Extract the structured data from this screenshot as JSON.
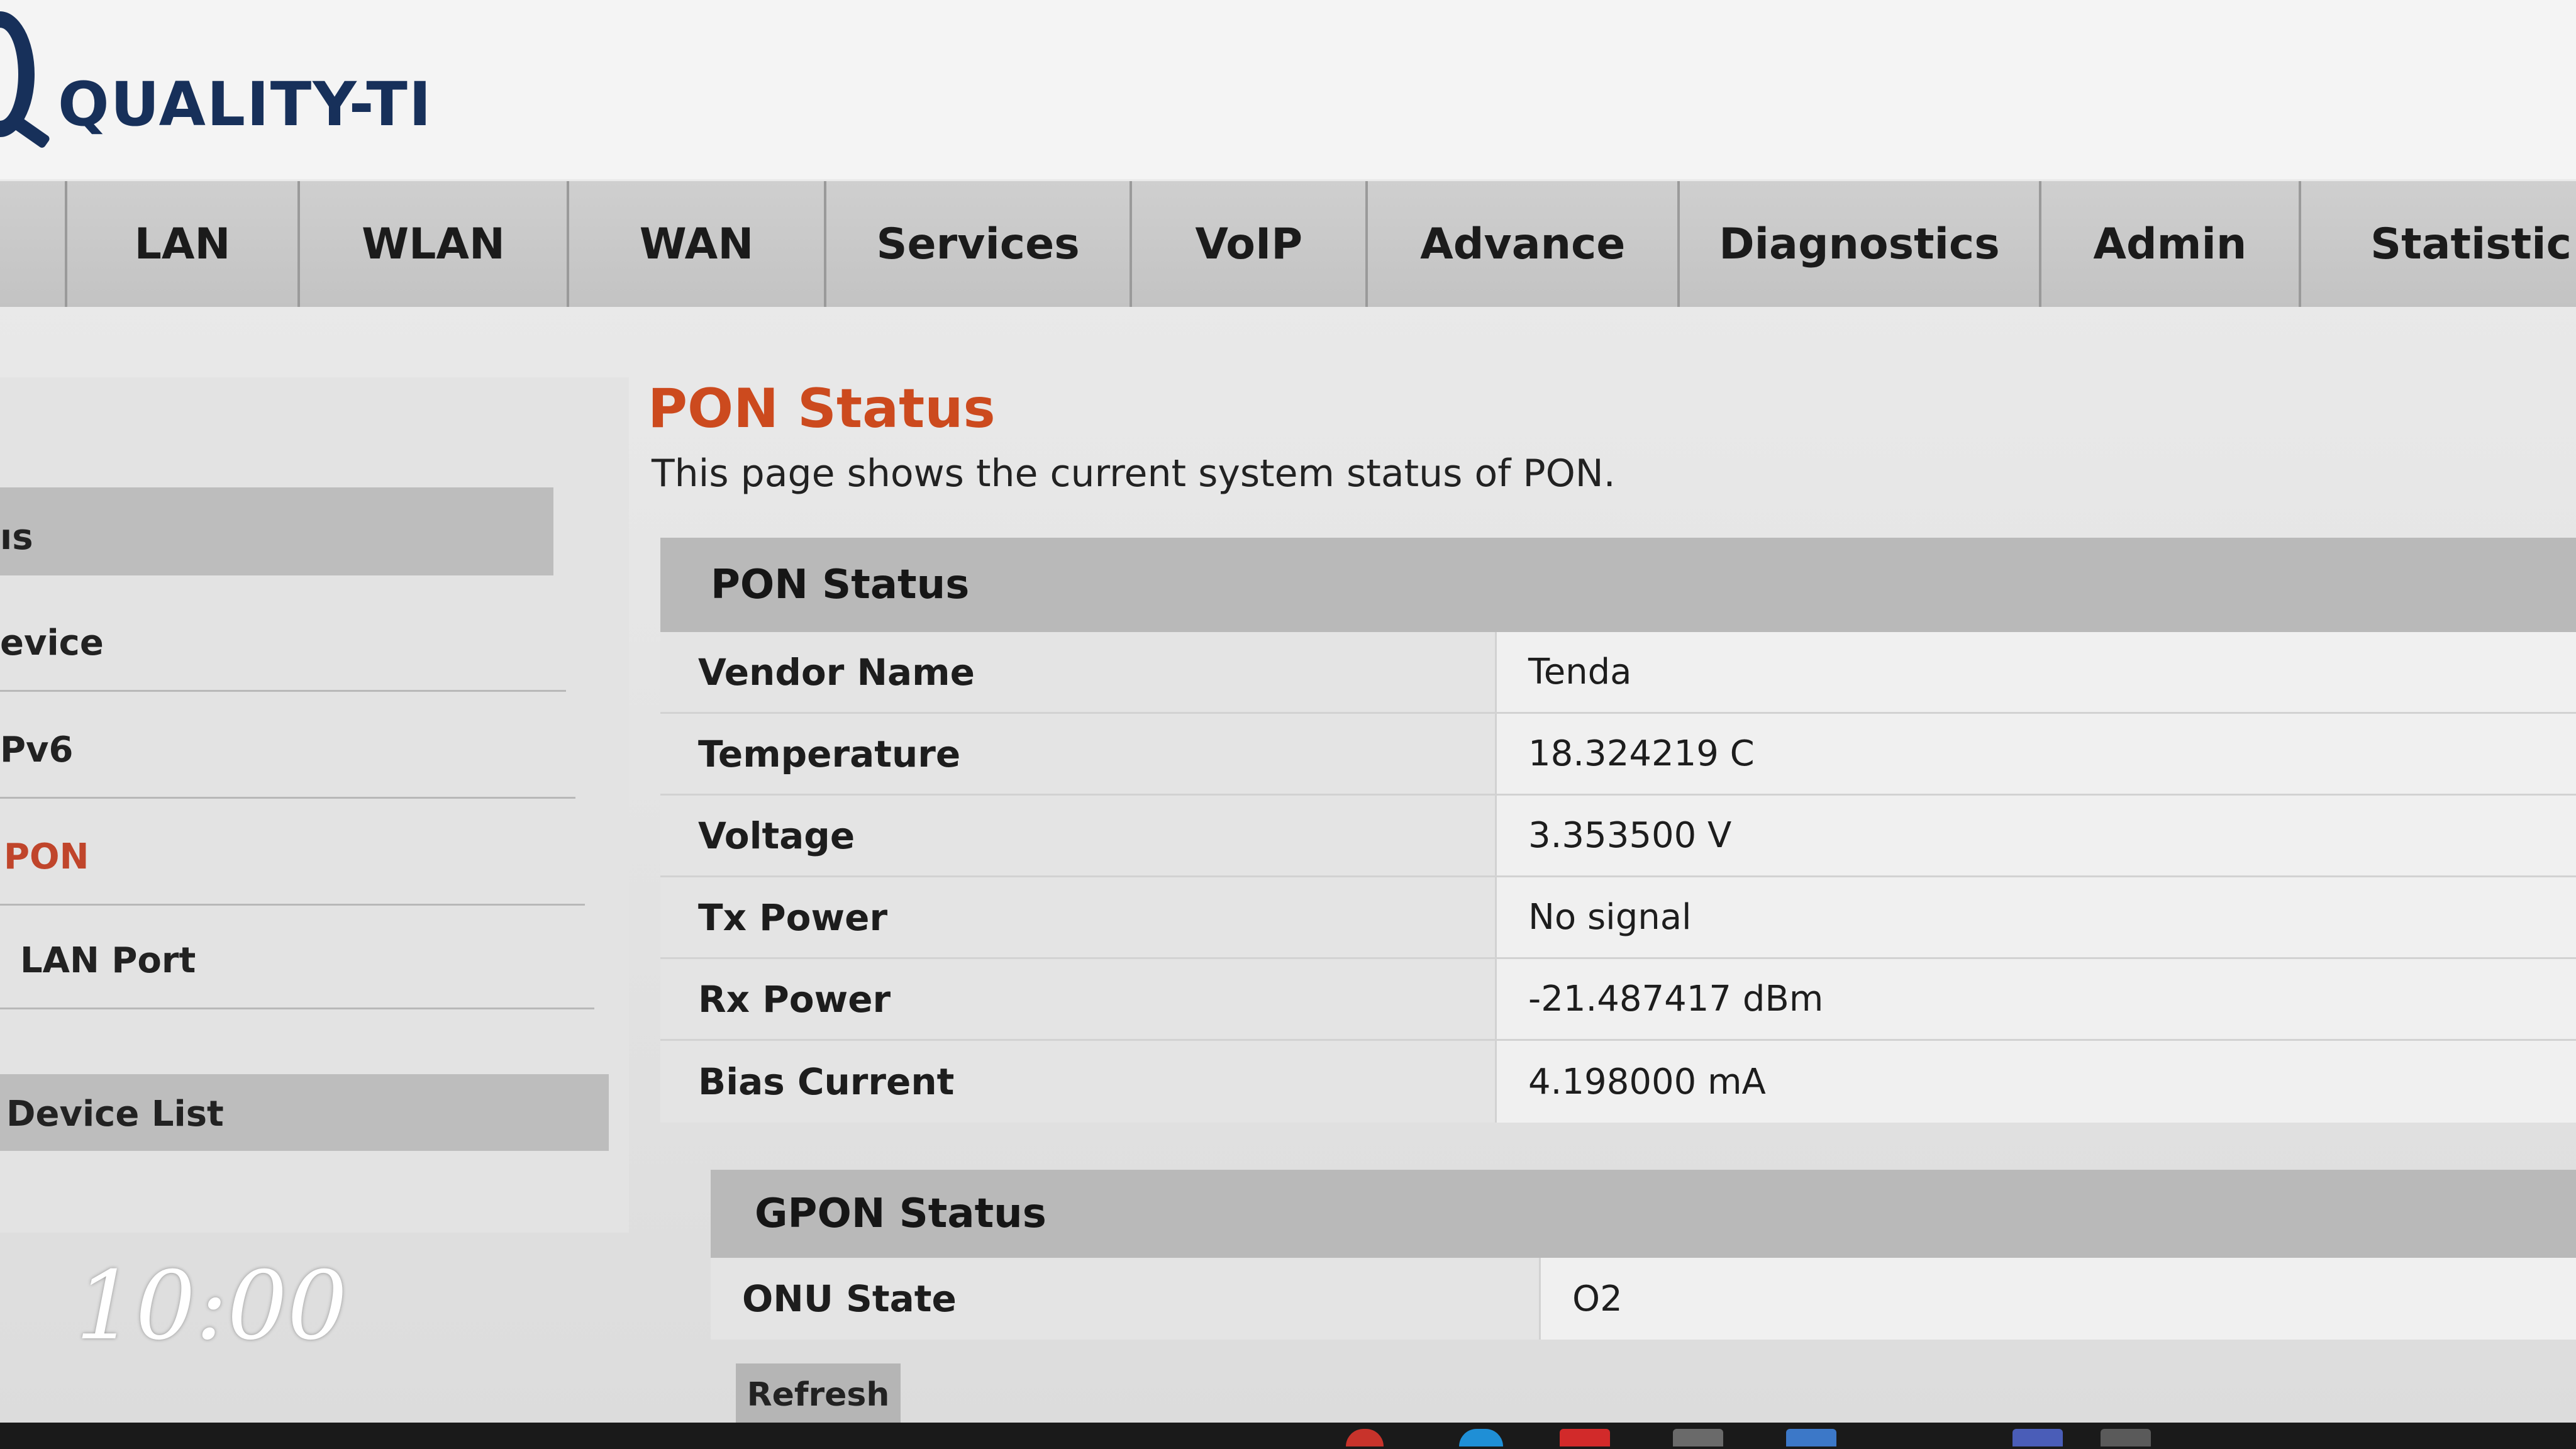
{
  "header": {
    "logo_text": "QUALITY-TI"
  },
  "nav": {
    "items": [
      {
        "label": "LAN"
      },
      {
        "label": "WLAN"
      },
      {
        "label": "WAN"
      },
      {
        "label": "Services"
      },
      {
        "label": "VoIP"
      },
      {
        "label": "Advance"
      },
      {
        "label": "Diagnostics"
      },
      {
        "label": "Admin"
      },
      {
        "label": "Statistic"
      }
    ]
  },
  "sidebar": {
    "items": [
      {
        "label": "ıs",
        "type": "header"
      },
      {
        "label": "evice"
      },
      {
        "label": "Pv6"
      },
      {
        "label": "PON",
        "active": true
      },
      {
        "label": "LAN Port"
      },
      {
        "label": "Device List",
        "type": "header"
      }
    ]
  },
  "page": {
    "title": "PON Status",
    "description": "This page shows the current system status of PON."
  },
  "pon_status": {
    "header": "PON Status",
    "rows": [
      {
        "label": "Vendor Name",
        "value": "Tenda"
      },
      {
        "label": "Temperature",
        "value": "18.324219 C"
      },
      {
        "label": "Voltage",
        "value": "3.353500 V"
      },
      {
        "label": "Tx Power",
        "value": "No signal"
      },
      {
        "label": "Rx Power",
        "value": "-21.487417 dBm"
      },
      {
        "label": "Bias Current",
        "value": "4.198000 mA"
      }
    ]
  },
  "gpon_status": {
    "header": "GPON Status",
    "rows": [
      {
        "label": "ONU State",
        "value": "O2"
      }
    ]
  },
  "refresh_label": "Refresh",
  "overlay": {
    "clock": "10:00"
  },
  "colors": {
    "brand": "#17305a",
    "title_accent": "#cc4a1e",
    "active_link": "#c0452b"
  }
}
